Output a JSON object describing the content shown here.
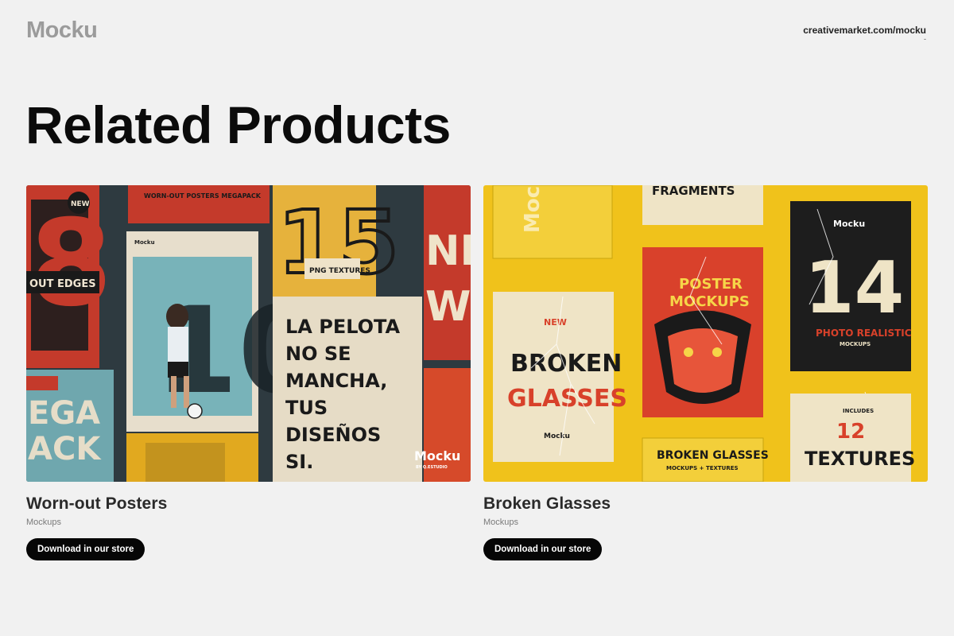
{
  "header": {
    "logo": "Mocku",
    "site_link": "creativemarket.com/mocku",
    "site_link_dash": "-"
  },
  "page": {
    "title": "Related Products"
  },
  "products": [
    {
      "title": "Worn-out Posters",
      "category": "Mockups",
      "button_label": "Download in our store",
      "image_texts": {
        "new_badge": "NEW",
        "megapack_title": "WORN-OUT POSTERS MEGAPACK",
        "big_number": "10",
        "textures": "PNG TEXTURES",
        "edges": "OUT EDGES",
        "quote_1": "LA PELOTA",
        "quote_2": "NO SE",
        "quote_3": "MANCHA,",
        "quote_4": "TUS",
        "quote_5": "DISEÑOS",
        "quote_6": "SI.",
        "footer_tag": "WORN-OUT POSTERS MEGAPACK",
        "brand": "Mocku",
        "brand_sub": "BY Q.ESTUDIO",
        "side_text": "EGA ACK",
        "poster_label": "WORN-OUT POSTERS"
      }
    },
    {
      "title": "Broken Glasses",
      "category": "Mockups",
      "button_label": "Download in our store",
      "image_texts": {
        "fragments": "FRAGMENTS",
        "brand_a": "Mocku",
        "num_14": "14",
        "photo_realistic": "PHOTO REALISTIC",
        "mockups_small": "MOCKUPS",
        "poster_title_1": "POSTER",
        "poster_title_2": "MOCKUPS",
        "new": "NEW",
        "broken": "BROKEN",
        "glasses": "GLASSES",
        "includes": "INCLUDES",
        "num_12": "12",
        "textures": "TEXTURES",
        "bottom_title": "BROKEN GLASSES",
        "bottom_sub": "MOCKUPS + TEXTURES"
      }
    }
  ]
}
